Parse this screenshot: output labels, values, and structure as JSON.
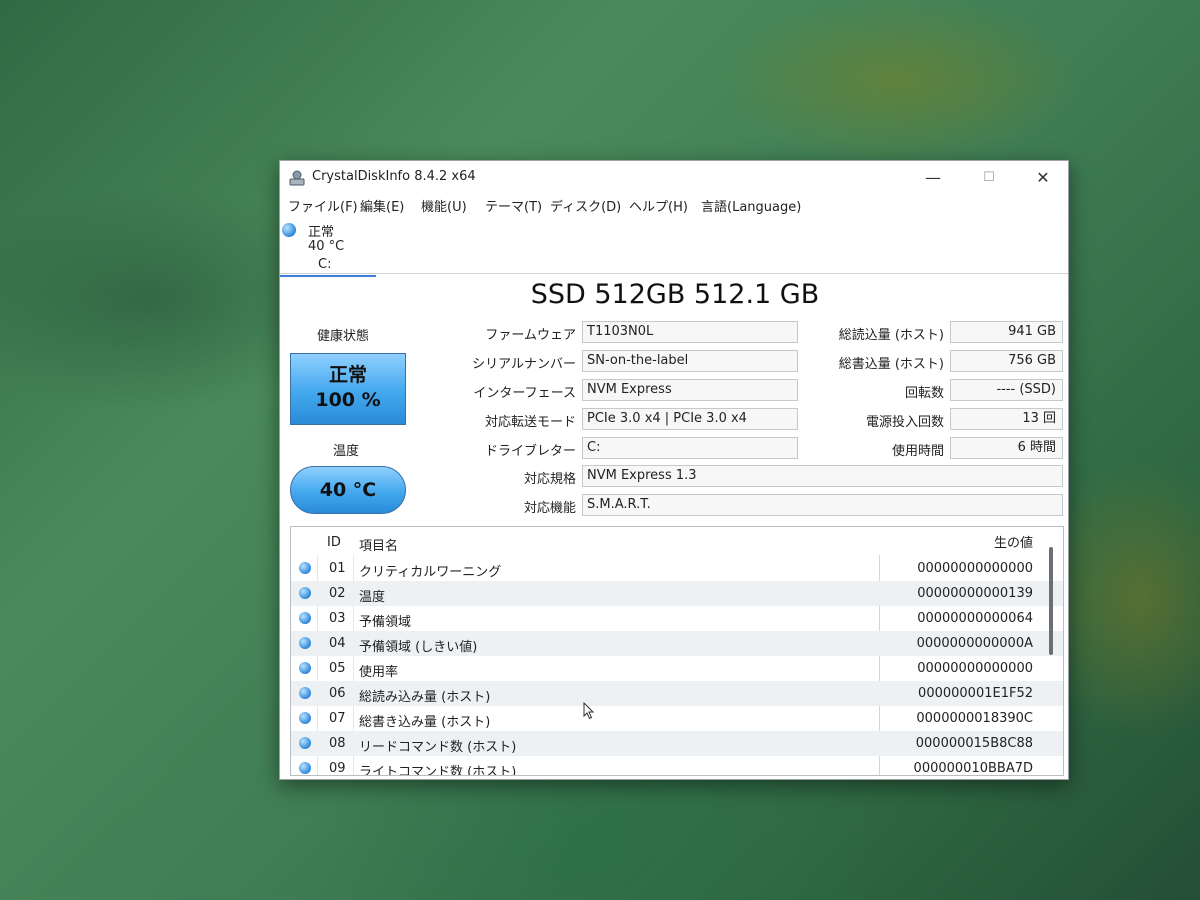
{
  "window": {
    "title": "CrystalDiskInfo 8.4.2 x64",
    "controls": {
      "minimize": "—",
      "maximize": "☐",
      "close": "✕"
    }
  },
  "menu": [
    "ファイル(F)",
    "編集(E)",
    "機能(U)",
    "テーマ(T)",
    "ディスク(D)",
    "ヘルプ(H)",
    "言語(Language)"
  ],
  "disk_tab": {
    "status": "正常",
    "temp": "40 °C",
    "drive": "C:"
  },
  "model": "SSD 512GB 512.1 GB",
  "health": {
    "label": "健康状態",
    "status": "正常",
    "percent": "100 %"
  },
  "temperature": {
    "label": "温度",
    "value": "40 °C"
  },
  "info_left": [
    {
      "label": "ファームウェア",
      "value": "T1103N0L"
    },
    {
      "label": "シリアルナンバー",
      "value": "SN-on-the-label"
    },
    {
      "label": "インターフェース",
      "value": "NVM Express"
    },
    {
      "label": "対応転送モード",
      "value": "PCIe 3.0 x4 | PCIe 3.0 x4"
    },
    {
      "label": "ドライブレター",
      "value": "C:"
    }
  ],
  "info_right": [
    {
      "label": "総読込量 (ホスト)",
      "value": "941 GB"
    },
    {
      "label": "総書込量 (ホスト)",
      "value": "756 GB"
    },
    {
      "label": "回転数",
      "value": "---- (SSD)"
    },
    {
      "label": "電源投入回数",
      "value": "13 回"
    },
    {
      "label": "使用時間",
      "value": "6 時間"
    }
  ],
  "info_wide": [
    {
      "label": "対応規格",
      "value": "NVM Express 1.3"
    },
    {
      "label": "対応機能",
      "value": "S.M.A.R.T."
    }
  ],
  "smart": {
    "headers": {
      "id": "ID",
      "name": "項目名",
      "raw": "生の値"
    },
    "rows": [
      {
        "id": "01",
        "name": "クリティカルワーニング",
        "raw": "00000000000000"
      },
      {
        "id": "02",
        "name": "温度",
        "raw": "00000000000139"
      },
      {
        "id": "03",
        "name": "予備領域",
        "raw": "00000000000064"
      },
      {
        "id": "04",
        "name": "予備領域 (しきい値)",
        "raw": "0000000000000A"
      },
      {
        "id": "05",
        "name": "使用率",
        "raw": "00000000000000"
      },
      {
        "id": "06",
        "name": "総読み込み量 (ホスト)",
        "raw": "000000001E1F52"
      },
      {
        "id": "07",
        "name": "総書き込み量 (ホスト)",
        "raw": "0000000018390C"
      },
      {
        "id": "08",
        "name": "リードコマンド数 (ホスト)",
        "raw": "000000015B8C88"
      },
      {
        "id": "09",
        "name": "ライトコマンド数 (ホスト)",
        "raw": "000000010BBA7D"
      }
    ]
  }
}
